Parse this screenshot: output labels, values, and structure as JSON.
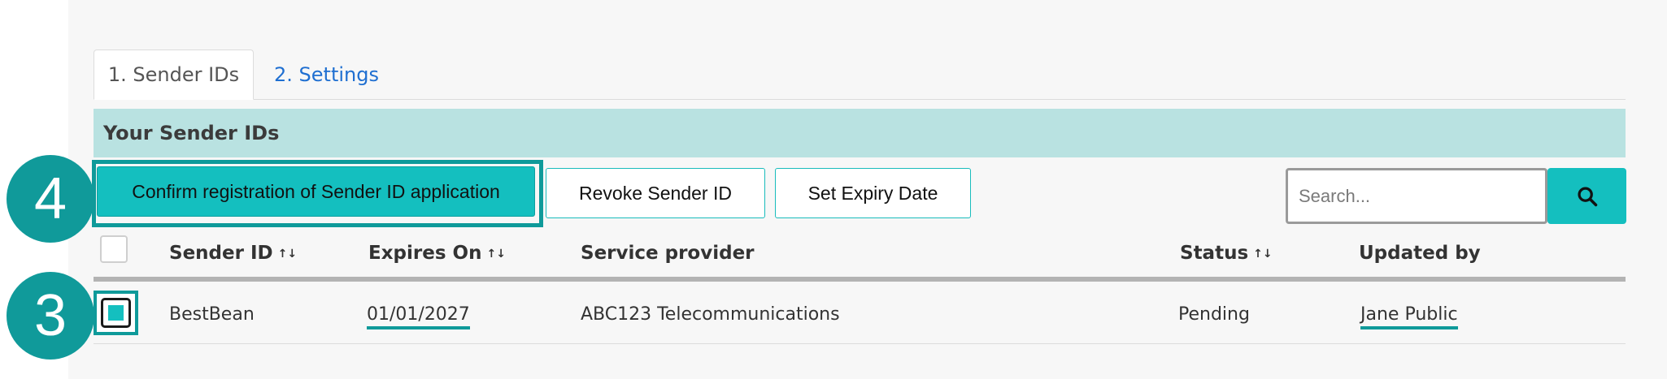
{
  "tabs": [
    {
      "label": "1. Sender IDs",
      "active": true
    },
    {
      "label": "2. Settings",
      "active": false
    }
  ],
  "section": {
    "title": "Your Sender IDs"
  },
  "toolbar": {
    "confirm_label": "Confirm registration of Sender ID application",
    "revoke_label": "Revoke Sender ID",
    "expiry_label": "Set Expiry Date"
  },
  "search": {
    "placeholder": "Search...",
    "icon": "search-icon"
  },
  "table": {
    "columns": [
      {
        "label": "Sender ID",
        "sortable": true
      },
      {
        "label": "Expires On",
        "sortable": true
      },
      {
        "label": "Service provider",
        "sortable": false
      },
      {
        "label": "Status",
        "sortable": true
      },
      {
        "label": "Updated by",
        "sortable": false
      }
    ],
    "sort_indicator": "↑↓",
    "rows": [
      {
        "selected": true,
        "sender_id": "BestBean",
        "expires_on": "01/01/2027",
        "service_provider": "ABC123 Telecommunications",
        "status": "Pending",
        "updated_by": "Jane Public"
      }
    ]
  },
  "annotations": {
    "step_confirm": "4",
    "step_select": "3"
  },
  "colors": {
    "accent": "#14bfbf",
    "accent_dark": "#0f9a9a",
    "section_bg": "#b9e2e1",
    "link": "#1f6fd1"
  }
}
